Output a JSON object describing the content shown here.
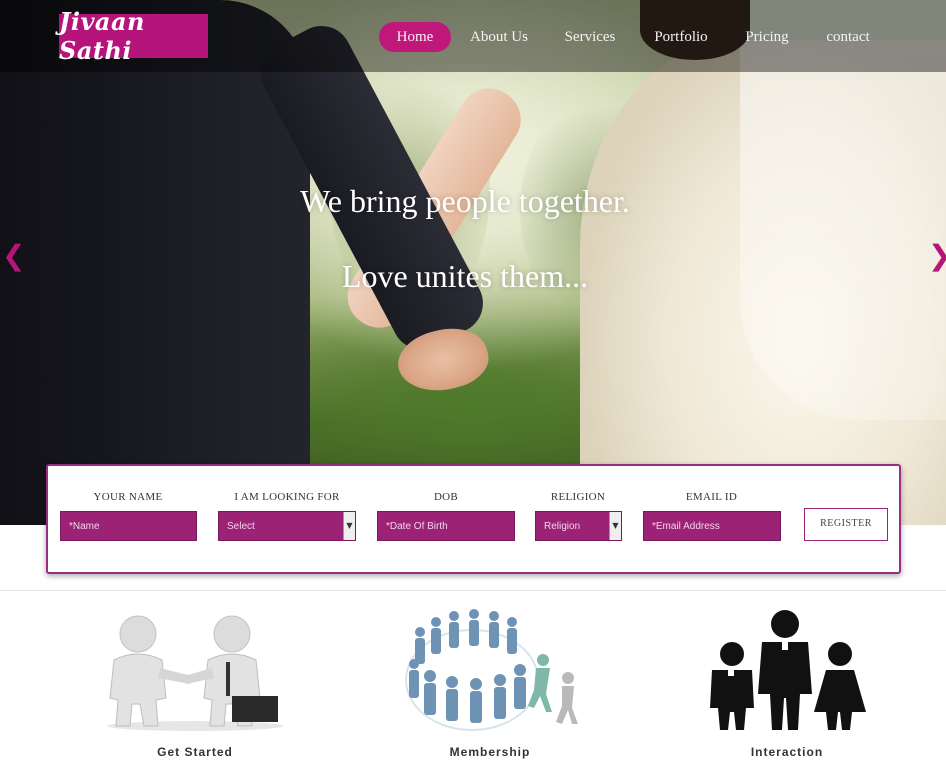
{
  "brand": {
    "logo_text": "Jivaan Sathi",
    "accent_color": "#b5147a"
  },
  "nav": {
    "items": [
      {
        "label": "Home",
        "active": true
      },
      {
        "label": "About Us",
        "active": false
      },
      {
        "label": "Services",
        "active": false
      },
      {
        "label": "Portfolio",
        "active": false
      },
      {
        "label": "Pricing",
        "active": false
      },
      {
        "label": "contact",
        "active": false
      }
    ]
  },
  "hero": {
    "headline": "We bring people together.",
    "subline": "Love unites them...",
    "prev_icon": "chevron-left-icon",
    "next_icon": "chevron-right-icon"
  },
  "register_form": {
    "name_label": "YOUR NAME",
    "name_placeholder": "*Name",
    "looking_for_label": "I AM LOOKING FOR",
    "looking_for_value": "Select",
    "dob_label": "DOB",
    "dob_placeholder": "*Date Of Birth",
    "religion_label": "RELIGION",
    "religion_value": "Religion",
    "email_label": "EMAIL ID",
    "email_placeholder": "*Email Address",
    "register_label": "REGISTER"
  },
  "features": [
    {
      "caption": "Get Started",
      "icon": "handshake-icon"
    },
    {
      "caption": "Membership",
      "icon": "people-circle-icon"
    },
    {
      "caption": "Interaction",
      "icon": "family-icon"
    }
  ]
}
